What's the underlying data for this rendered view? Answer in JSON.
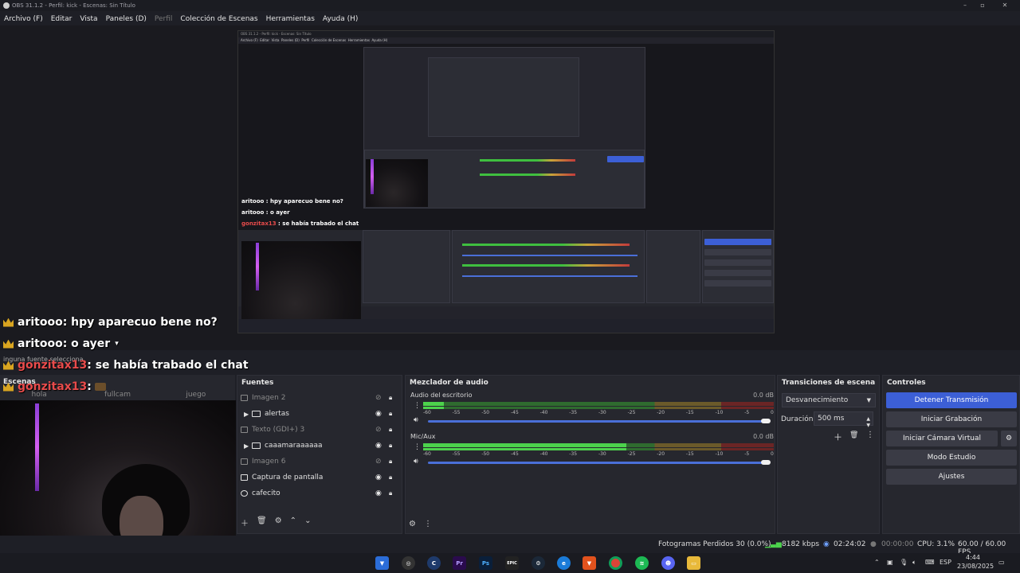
{
  "window": {
    "title": "OBS 31.1.2 - Perfil: kick - Escenas: Sin Título",
    "minimize": "–",
    "maximize": "▫",
    "close": "✕"
  },
  "menu": {
    "archivo": "Archivo (F)",
    "editar": "Editar",
    "vista": "Vista",
    "paneles": "Paneles (D)",
    "perfil": "Perfil",
    "coleccion": "Colección de Escenas",
    "herramientas": "Herramientas",
    "ayuda": "Ayuda (H)"
  },
  "chat": [
    {
      "user": "aritooo",
      "message": " : hpy aparecuo bene no?"
    },
    {
      "user": "aritooo",
      "message": " : o ayer"
    },
    {
      "user": "gonzitax13",
      "message": " : se había trabado el chat"
    },
    {
      "user": "gonzitax13",
      "message": " :"
    }
  ],
  "nested_chat": [
    {
      "user": "aritooo",
      "message": " : hpy aparecuo bene no?"
    },
    {
      "user": "aritooo",
      "message": " : o ayer"
    },
    {
      "user": "gonzitax13",
      "message": " : se había trabado el chat"
    }
  ],
  "scenes": {
    "title": "Escenas",
    "overlay_text": "inguna fuente selecciona",
    "columns": [
      "hola",
      "fullcam",
      "juego"
    ]
  },
  "sources": {
    "title": "Fuentes",
    "items": [
      {
        "name": "Imagen 2",
        "dim": true,
        "type": "image"
      },
      {
        "name": "alertas",
        "dim": false,
        "type": "folder"
      },
      {
        "name": "Texto (GDI+) 3",
        "dim": true,
        "type": "text"
      },
      {
        "name": "caaamaraaaaaa",
        "dim": false,
        "type": "folder"
      },
      {
        "name": "Imagen 6",
        "dim": true,
        "type": "image"
      },
      {
        "name": "Captura de pantalla",
        "dim": false,
        "type": "display"
      },
      {
        "name": "cafecito",
        "dim": false,
        "type": "browser"
      }
    ]
  },
  "mixer": {
    "title": "Mezclador de audio",
    "channels": [
      {
        "name": "Audio del escritorio",
        "db": "0.0 dB",
        "level": 0.06
      },
      {
        "name": "Mic/Aux",
        "db": "0.0 dB",
        "level": 0.58
      }
    ],
    "scale": [
      "-60",
      "-55",
      "-50",
      "-45",
      "-40",
      "-35",
      "-30",
      "-25",
      "-20",
      "-15",
      "-10",
      "-5",
      "0"
    ]
  },
  "transitions": {
    "title": "Transiciones de escena",
    "selected": "Desvanecimiento",
    "duration_label": "Duración",
    "duration_value": "500 ms"
  },
  "controls": {
    "title": "Controles",
    "stop_stream": "Detener Transmisión",
    "start_recording": "Iniciar Grabación",
    "start_virtual_cam": "Iniciar Cámara Virtual",
    "studio_mode": "Modo Estudio",
    "settings": "Ajustes"
  },
  "status": {
    "dropped_frames": "Fotogramas Perdidos 30 (0.0%)",
    "bitrate": "8182 kbps",
    "stream_time": "02:24:02",
    "rec_time": "00:00:00",
    "cpu": "CPU: 3.1%",
    "fps": "60.00 / 60.00 FPS"
  },
  "taskbar": {
    "lang": "ESP",
    "time": "4:44",
    "date": "23/08/2025",
    "apps": [
      "Pr",
      "Ps",
      "EPIC"
    ]
  },
  "colors": {
    "accent": "#3c5fd6",
    "meter_green": "#4cd24c",
    "chat_user_red": "#e84b4b",
    "crown": "#d9a520"
  }
}
